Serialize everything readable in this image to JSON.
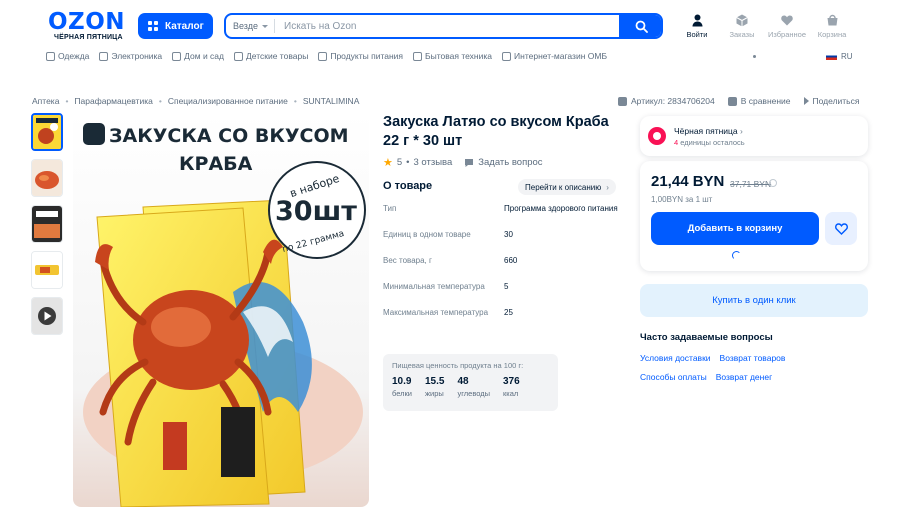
{
  "header": {
    "brand": "OZON",
    "brand_tag": "ЧЁРНАЯ ПЯТНИЦА",
    "catalog_label": "Каталог",
    "search": {
      "scope": "Везде",
      "placeholder": "Искать на Ozon"
    },
    "icons": [
      {
        "name": "user-icon",
        "label": "Войти"
      },
      {
        "name": "box-icon",
        "label": "Заказы"
      },
      {
        "name": "heart-icon",
        "label": "Избранное"
      },
      {
        "name": "cart-icon",
        "label": "Корзина"
      }
    ]
  },
  "categories": [
    "Одежда",
    "Электроника",
    "Дом и сад",
    "Детские товары",
    "Продукты питания",
    "Бытовая техника",
    "Интернет-магазин ОМБ"
  ],
  "language": "RU",
  "breadcrumbs": [
    "Аптека",
    "Парафармацевтика",
    "Специализированное питание",
    "SUNTALIMINA"
  ],
  "meta_bar": {
    "article": "Артикул: 2834706204",
    "compare": "В сравнение",
    "share": "Поделиться"
  },
  "product": {
    "title": "Закуска Латяо со вкусом Краба 22 г * 30 шт",
    "rating": "5",
    "reviews": "3 отзыва",
    "ask": "Задать вопрос",
    "image": {
      "headline_1": "ЗАКУСКА СО ВКУСОМ",
      "headline_2": "КРАБА",
      "badge_top": "в наборе",
      "badge_main": "30шт",
      "badge_bottom": "по 22 грамма"
    }
  },
  "about": {
    "title": "О товаре",
    "to_description": "Перейти к описанию",
    "specs": [
      {
        "key": "Тип",
        "value": "Программа здорового питания"
      },
      {
        "key": "Единиц в одном товаре",
        "value": "30"
      },
      {
        "key": "Вес товара, г",
        "value": "660"
      },
      {
        "key": "Минимальная температура",
        "value": "5"
      },
      {
        "key": "Максимальная температура",
        "value": "25"
      }
    ]
  },
  "nutrition": {
    "title": "Пищевая ценность продукта на 100 г:",
    "values": [
      {
        "value": "10.9",
        "label": "белки"
      },
      {
        "value": "15.5",
        "label": "жиры"
      },
      {
        "value": "48",
        "label": "углеводы"
      },
      {
        "value": "376",
        "label": "ккал"
      }
    ]
  },
  "promo": {
    "title": "Чёрная пятница",
    "count": "4",
    "subtitle": "единицы осталось"
  },
  "price": {
    "current": "21,44 BYN",
    "old": "37,71 BYN",
    "per_unit": "1,00BYN за 1 шт",
    "add_to_cart": "Добавить в корзину",
    "one_click": "Купить в один клик"
  },
  "faq": {
    "title": "Часто задаваемые вопросы",
    "links": [
      "Условия доставки",
      "Возврат товаров",
      "Способы оплаты",
      "Возврат денег"
    ]
  },
  "colors": {
    "accent": "#005bff",
    "promo": "#f91155",
    "rating": "#ffa800"
  }
}
